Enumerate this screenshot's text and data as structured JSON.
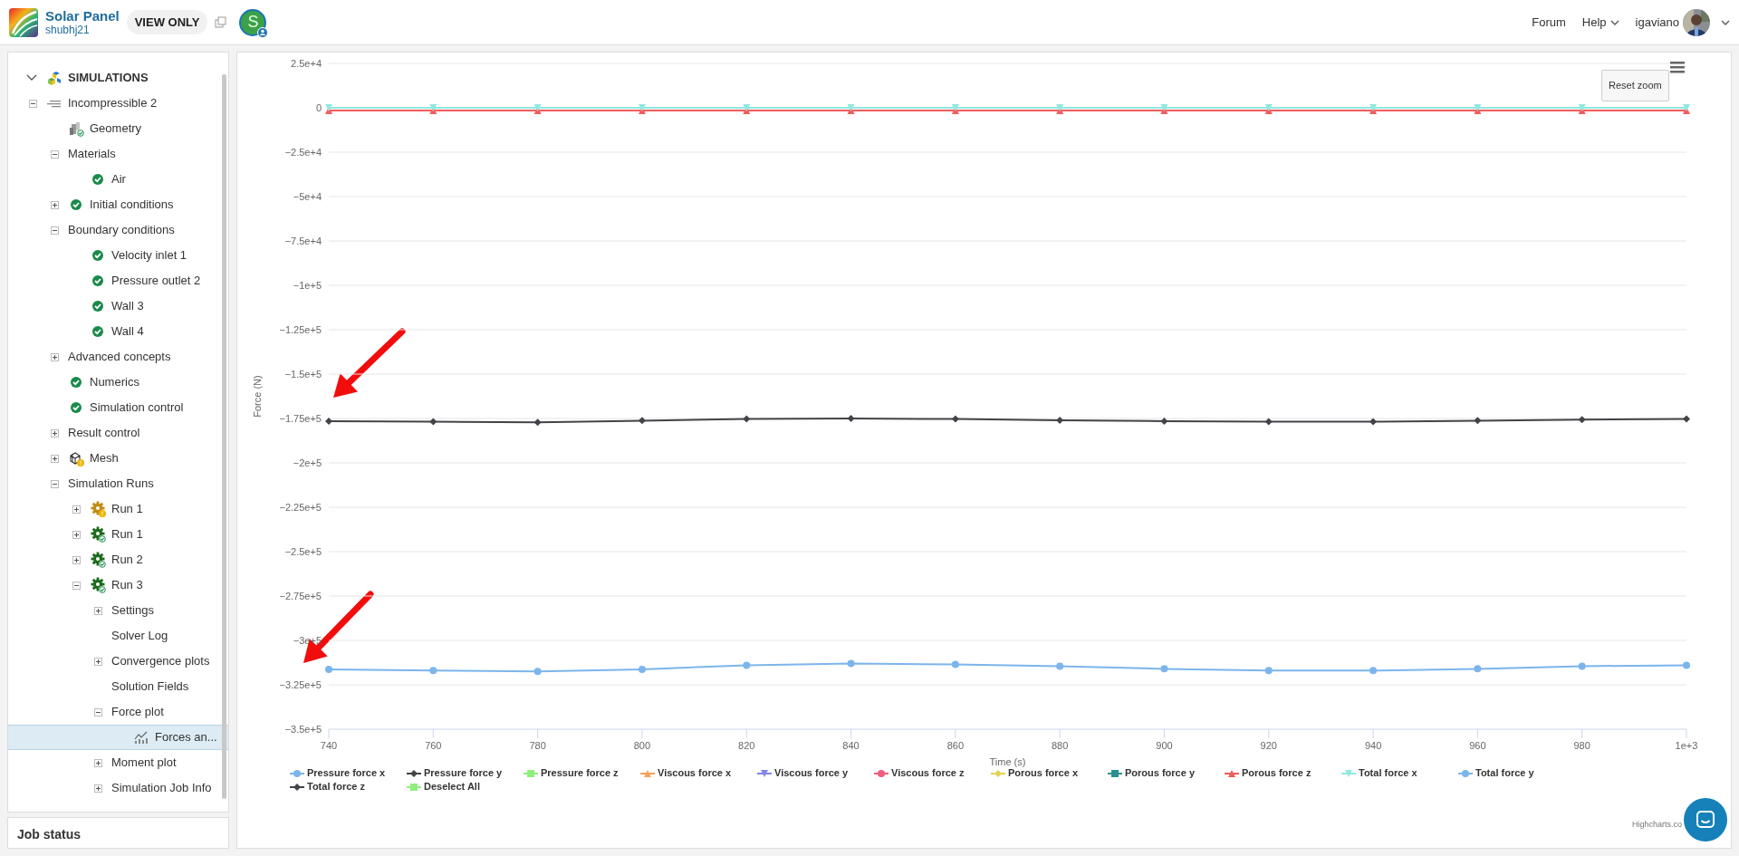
{
  "header": {
    "title": "Solar Panel",
    "owner": "shubhj21",
    "access_badge": "VIEW ONLY",
    "project_avatar": "S",
    "links": [
      {
        "label": "Forum",
        "dropdown": false
      },
      {
        "label": "Help",
        "dropdown": true
      }
    ],
    "user": "igaviano"
  },
  "sidebar": {
    "section": {
      "label": "SIMULATIONS",
      "expanded": true
    },
    "tree": [
      {
        "label": "Incompressible 2",
        "kind": "model",
        "expanded": true,
        "selected": false,
        "children": [
          {
            "label": "Geometry",
            "kind": "geometry",
            "warning": false,
            "selected": false
          },
          {
            "label": "Materials",
            "expanded": true,
            "selected": false,
            "children": [
              {
                "label": "Air",
                "kind": "check",
                "selected": false
              }
            ]
          },
          {
            "label": "Initial conditions",
            "kind": "check",
            "expanded": false,
            "selected": false
          },
          {
            "label": "Boundary conditions",
            "expanded": true,
            "selected": false,
            "children": [
              {
                "label": "Velocity inlet 1",
                "kind": "check",
                "selected": false
              },
              {
                "label": "Pressure outlet 2",
                "kind": "check",
                "selected": false
              },
              {
                "label": "Wall 3",
                "kind": "check",
                "selected": false
              },
              {
                "label": "Wall 4",
                "kind": "check",
                "selected": false
              }
            ]
          },
          {
            "label": "Advanced concepts",
            "expanded": false,
            "selected": false
          },
          {
            "label": "Numerics",
            "kind": "check",
            "selected": false
          },
          {
            "label": "Simulation control",
            "kind": "check",
            "selected": false
          },
          {
            "label": "Result control",
            "expanded": false,
            "selected": false
          },
          {
            "label": "Mesh",
            "kind": "mesh",
            "warning": true,
            "expanded": false,
            "selected": false
          },
          {
            "label": "Simulation Runs",
            "expanded": true,
            "selected": false,
            "children": [
              {
                "label": "Run 1",
                "kind": "run",
                "warning": true,
                "expanded": false,
                "selected": false
              },
              {
                "label": "Run 1",
                "kind": "run",
                "warning": false,
                "expanded": false,
                "selected": false
              },
              {
                "label": "Run 2",
                "kind": "run",
                "warning": false,
                "expanded": false,
                "selected": false
              },
              {
                "label": "Run 3",
                "kind": "run",
                "warning": false,
                "expanded": true,
                "selected": false,
                "children": [
                  {
                    "label": "Settings",
                    "expanded": false,
                    "selected": false
                  },
                  {
                    "label": "Solver Log",
                    "selected": false
                  },
                  {
                    "label": "Convergence plots",
                    "expanded": false,
                    "selected": false
                  },
                  {
                    "label": "Solution Fields",
                    "selected": false
                  },
                  {
                    "label": "Force plot",
                    "expanded": true,
                    "selected": false,
                    "children": [
                      {
                        "label": "Forces an...",
                        "kind": "chart",
                        "selected": true
                      }
                    ]
                  },
                  {
                    "label": "Moment plot",
                    "expanded": false,
                    "selected": false
                  },
                  {
                    "label": "Simulation Job Info",
                    "expanded": false,
                    "selected": false
                  }
                ]
              }
            ]
          }
        ]
      }
    ],
    "footer": "Job status"
  },
  "chart": {
    "reset_button": "Reset zoom",
    "credit": "Highcharts.co",
    "chart_data": {
      "type": "line",
      "xlabel": "Time (s)",
      "ylabel": "Force (N)",
      "grid": true,
      "x": [
        740,
        760,
        780,
        800,
        820,
        840,
        860,
        880,
        900,
        920,
        940,
        960,
        980,
        1000
      ],
      "xlim": [
        740,
        1000
      ],
      "ylim": [
        -350000,
        25000
      ],
      "xticks": [
        740,
        760,
        780,
        800,
        820,
        840,
        860,
        880,
        900,
        920,
        940,
        960,
        980,
        {
          "value": 1000,
          "label": "1e+3"
        }
      ],
      "yticks": [
        {
          "value": 25000,
          "label": "2.5e+4"
        },
        {
          "value": 0,
          "label": "0"
        },
        {
          "value": -25000,
          "label": "−2.5e+4"
        },
        {
          "value": -50000,
          "label": "−5e+4"
        },
        {
          "value": -75000,
          "label": "−7.5e+4"
        },
        {
          "value": -100000,
          "label": "−1e+5"
        },
        {
          "value": -125000,
          "label": "−1.25e+5"
        },
        {
          "value": -150000,
          "label": "−1.5e+5"
        },
        {
          "value": -175000,
          "label": "−1.75e+5"
        },
        {
          "value": -200000,
          "label": "−2e+5"
        },
        {
          "value": -225000,
          "label": "−2.25e+5"
        },
        {
          "value": -250000,
          "label": "−2.5e+5"
        },
        {
          "value": -275000,
          "label": "−2.75e+5"
        },
        {
          "value": -300000,
          "label": "−3e+5"
        },
        {
          "value": -325000,
          "label": "−3.25e+5"
        },
        {
          "value": -350000,
          "label": "−3.5e+5"
        }
      ],
      "series": [
        {
          "name": "Pressure force x",
          "color": "#7cb5ec",
          "marker": "circle",
          "values": [
            -316300,
            -317000,
            -317500,
            -316300,
            -314000,
            -313000,
            -313500,
            -314500,
            -316000,
            -317000,
            -317000,
            -316000,
            -314500,
            -314000
          ]
        },
        {
          "name": "Pressure force y",
          "color": "#434348",
          "marker": "diamond",
          "values": [
            -176500,
            -176800,
            -177200,
            -176200,
            -175300,
            -175000,
            -175300,
            -176000,
            -176500,
            -176800,
            -176800,
            -176200,
            -175600,
            -175300
          ]
        },
        {
          "name": "Pressure force z",
          "color": "#90ed7d",
          "marker": "square",
          "values": [
            null,
            null,
            null,
            null,
            null,
            null,
            null,
            null,
            null,
            null,
            null,
            null,
            null,
            null
          ]
        },
        {
          "name": "Viscous force x",
          "color": "#f7a35c",
          "marker": "triangle",
          "values": [
            null,
            null,
            null,
            null,
            null,
            null,
            null,
            null,
            null,
            null,
            null,
            null,
            null,
            null
          ]
        },
        {
          "name": "Viscous force y",
          "color": "#8085e9",
          "marker": "triangle-down",
          "values": [
            null,
            null,
            null,
            null,
            null,
            null,
            null,
            null,
            null,
            null,
            null,
            null,
            null,
            null
          ]
        },
        {
          "name": "Viscous force z",
          "color": "#f15c80",
          "marker": "circle",
          "values": [
            null,
            null,
            null,
            null,
            null,
            null,
            null,
            null,
            null,
            null,
            null,
            null,
            null,
            null
          ]
        },
        {
          "name": "Porous force x",
          "color": "#e4d354",
          "marker": "diamond",
          "values": [
            null,
            null,
            null,
            null,
            null,
            null,
            null,
            null,
            null,
            null,
            null,
            null,
            null,
            null
          ]
        },
        {
          "name": "Porous force y",
          "color": "#2b908f",
          "marker": "square",
          "values": [
            null,
            null,
            null,
            null,
            null,
            null,
            null,
            null,
            null,
            null,
            null,
            null,
            null,
            null
          ]
        },
        {
          "name": "Porous force z",
          "color": "#f45b5b",
          "marker": "triangle",
          "values": [
            -1500,
            -1500,
            -1500,
            -1500,
            -1500,
            -1500,
            -1500,
            -1500,
            -1500,
            -1500,
            -1500,
            -1500,
            -1500,
            -1500
          ]
        },
        {
          "name": "Total force x",
          "color": "#91e8e1",
          "marker": "triangle-down",
          "values": [
            0,
            0,
            0,
            0,
            0,
            0,
            0,
            0,
            0,
            0,
            0,
            0,
            0,
            0
          ]
        },
        {
          "name": "Total force y",
          "color": "#7cb5ec",
          "marker": "circle",
          "values": [
            null,
            null,
            null,
            null,
            null,
            null,
            null,
            null,
            null,
            null,
            null,
            null,
            null,
            null
          ]
        },
        {
          "name": "Total force z",
          "color": "#434348",
          "marker": "diamond",
          "values": [
            null,
            null,
            null,
            null,
            null,
            null,
            null,
            null,
            null,
            null,
            null,
            null,
            null,
            null
          ]
        }
      ]
    },
    "legend_extra": {
      "label": "Deselect All",
      "color": "#90ed7d"
    },
    "markup_arrows": [
      {
        "color": "#f20d0d"
      },
      {
        "color": "#f20d0d"
      }
    ]
  }
}
